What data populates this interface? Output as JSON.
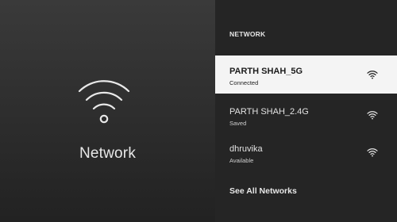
{
  "hero": {
    "icon": "wifi-icon",
    "label": "Network"
  },
  "networks_panel": {
    "header": "NETWORK",
    "items": [
      {
        "name": "PARTH SHAH_5G",
        "status": "Connected",
        "icon": "wifi-icon",
        "selected": true
      },
      {
        "name": "PARTH SHAH_2.4G",
        "status": "Saved",
        "icon": "wifi-icon",
        "selected": false
      },
      {
        "name": "dhruvika",
        "status": "Available",
        "icon": "wifi-icon",
        "selected": false
      }
    ],
    "see_all_label": "See All Networks"
  },
  "colors": {
    "selected_background": "#f4f4f4",
    "panel_background": "#252525",
    "text_light": "#e8e8e8",
    "text_dark": "#1c1c1c"
  }
}
